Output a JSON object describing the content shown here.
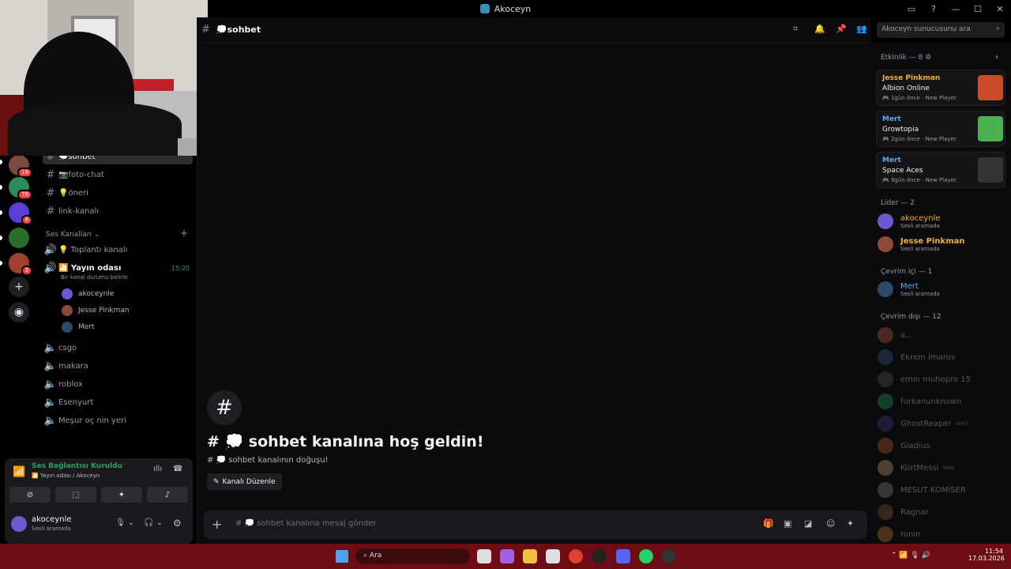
{
  "window": {
    "title": "Akoceyn"
  },
  "servers": [
    {
      "badge": "19",
      "color": "#7a4a3a"
    },
    {
      "badge": "79",
      "color": "#2e8b57"
    },
    {
      "badge": "8",
      "color": "#5b3fd6"
    },
    {
      "badge": "",
      "color": "#2a6e2a"
    },
    {
      "badge": "3",
      "color": "#a04030"
    }
  ],
  "channels": {
    "text": [
      {
        "name": "💭sohbet",
        "active": true
      },
      {
        "name": "📷foto-chat"
      },
      {
        "name": "💡öneri"
      },
      {
        "name": "link-kanalı"
      }
    ],
    "voice_category": "Ses Kanalları",
    "voice": [
      {
        "name": "💡 Toplantı kanalı"
      },
      {
        "name": "🎦 Yayın odası",
        "time": "15:20",
        "status": "Bir kanal durumu belirle"
      }
    ],
    "voice_users": [
      "akoceynle",
      "Jesse Pinkman",
      "Mert"
    ],
    "voice_more": [
      "csgo",
      "makara",
      "roblox",
      "Esenyurt",
      "Meşur oç nin yeri"
    ]
  },
  "voice_panel": {
    "title": "Ses Bağlantısı Kuruldu",
    "subtitle": "🎦 Yayın odası / Akoceyn",
    "user": "akoceynle",
    "user_status": "Sesli aramada"
  },
  "header": {
    "channel": "💭sohbet",
    "search_placeholder": "Akoceyn sunucusunu ara"
  },
  "welcome": {
    "title": "# 💭 sohbet kanalına hoş geldin!",
    "subtitle": "# 💭 sohbet kanalının doğuşu!",
    "edit_button": "Kanalı Düzenle"
  },
  "composer": {
    "placeholder": "# 💭 sohbet kanalına mesaj gönder"
  },
  "activity": {
    "header": "Etkinlik — 8",
    "cards": [
      {
        "user": "Jesse Pinkman",
        "game": "Albion Online",
        "time": "1gün önce",
        "tag": "New Player",
        "user_color": "#f0b232",
        "thumb": "#c94a2a"
      },
      {
        "user": "Mert",
        "game": "Growtopia",
        "time": "2gün önce",
        "tag": "New Player",
        "user_color": "#5ea7e8",
        "thumb": "#4caf50"
      },
      {
        "user": "Mert",
        "game": "Space Aces",
        "time": "9gün önce",
        "tag": "New Player",
        "user_color": "#5ea7e8",
        "thumb": "#333333"
      }
    ]
  },
  "members": {
    "leader_header": "Lider — 2",
    "leaders": [
      {
        "name": "akoceynle",
        "status": "Sesli aramada",
        "color": "#f0b232"
      },
      {
        "name": "Jesse Pinkman",
        "status": "Sesli aramada",
        "color": "#f0b232"
      }
    ],
    "online_header": "Çevrim içi — 1",
    "online": [
      {
        "name": "Mert",
        "status": "Sesli aramada",
        "color": "#5ea7e8"
      }
    ],
    "offline_header": "Çevrim dışı — 12",
    "offline": [
      {
        "name": "a..."
      },
      {
        "name": "Ekrem İmarov"
      },
      {
        "name": "emin muhopro 15"
      },
      {
        "name": "furkanunknown"
      },
      {
        "name": "GhostReaper",
        "tag": "GHST"
      },
      {
        "name": "Gladius"
      },
      {
        "name": "KürtMessi",
        "tag": "NNW"
      },
      {
        "name": "MESUT KOMİSER"
      },
      {
        "name": "Ragnar"
      },
      {
        "name": "ronin"
      }
    ]
  },
  "taskbar": {
    "search": "Ara",
    "time": "11:54",
    "date": "17.03.2026"
  }
}
